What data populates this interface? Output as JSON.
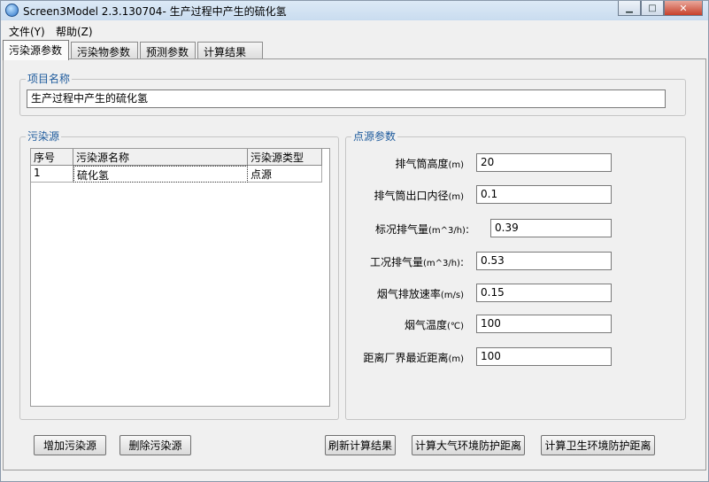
{
  "window": {
    "title": "Screen3Model 2.3.130704- 生产过程中产生的硫化氢",
    "minimize_glyph": "▁",
    "maximize_glyph": "□",
    "close_glyph": "✕"
  },
  "menu": {
    "items": [
      "文件(Y)",
      "帮助(Z)"
    ]
  },
  "tabs": [
    "污染源参数",
    "污染物参数",
    "预测参数",
    "计算结果"
  ],
  "active_tab": "污染源参数",
  "project": {
    "legend": "项目名称",
    "name": "生产过程中产生的硫化氢"
  },
  "sources": {
    "legend": "污染源",
    "columns": [
      "序号",
      "污染源名称",
      "污染源类型"
    ],
    "rows": [
      [
        "1",
        "硫化氢",
        "点源"
      ]
    ]
  },
  "point_params": {
    "legend": "点源参数",
    "fields": [
      {
        "label": "排气筒高度",
        "unit": "(m)",
        "value": "20"
      },
      {
        "label": "排气筒出口内径",
        "unit": "(m)",
        "value": "0.1"
      },
      {
        "label": "标况排气量",
        "unit": "(m^3/h)",
        "value": "0.39"
      },
      {
        "label": "工况排气量",
        "unit": "(m^3/h)",
        "value": "0.53"
      },
      {
        "label": "烟气排放速率",
        "unit": "(m/s)",
        "value": "0.15"
      },
      {
        "label": "烟气温度",
        "unit": "(℃)",
        "value": "100"
      },
      {
        "label": "距离厂界最近距离",
        "unit": "(m)",
        "value": "100"
      }
    ]
  },
  "buttons": {
    "add_source": "增加污染源",
    "delete_source": "删除污染源",
    "refresh_results": "刷新计算结果",
    "calc_atmos_distance": "计算大气环境防护距离",
    "calc_sanitary_distance": "计算卫生环境防护距离"
  }
}
